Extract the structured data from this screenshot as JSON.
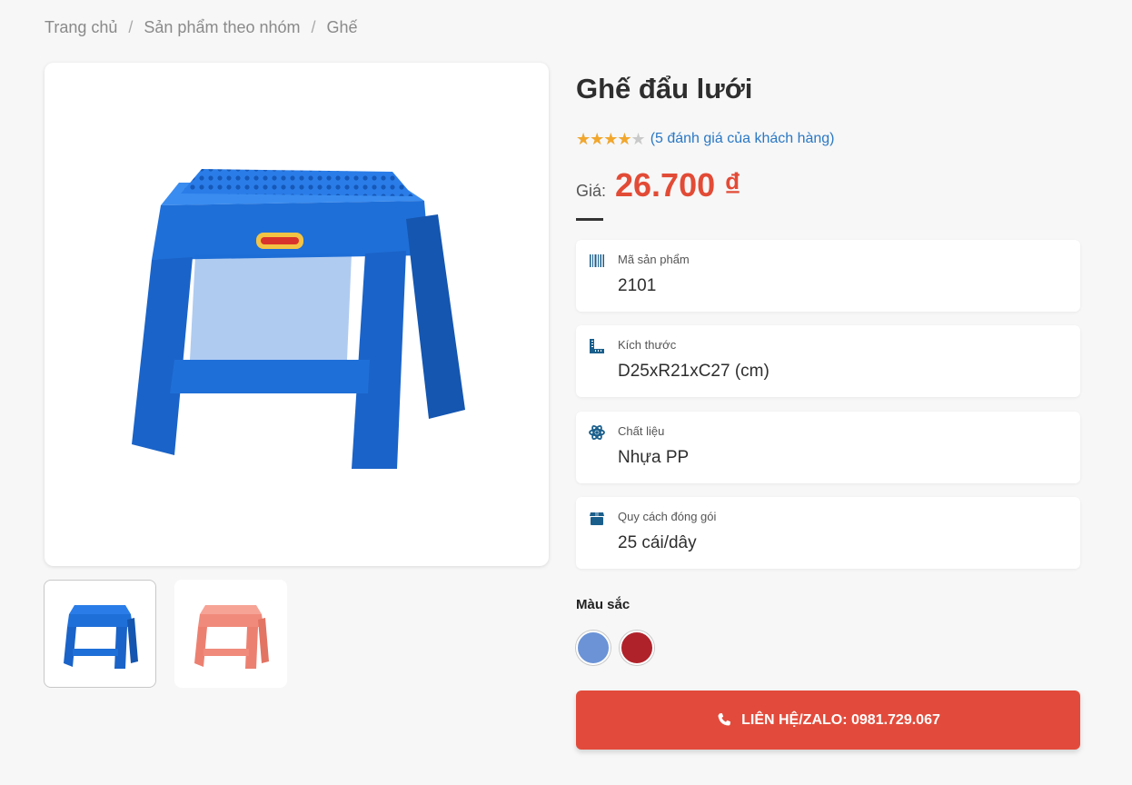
{
  "breadcrumb": {
    "items": [
      "Trang chủ",
      "Sản phẩm theo nhóm",
      "Ghế"
    ],
    "separator": "/"
  },
  "product": {
    "title": "Ghế đẩu lưới",
    "rating": {
      "value": 4,
      "max": 5,
      "review_text": "(5 đánh giá của khách hàng)"
    },
    "price_label": "Giá:",
    "price": "26.700 ₫"
  },
  "gallery": {
    "thumbnails": [
      {
        "color": "#1f6fd8",
        "active": true
      },
      {
        "color": "#f08a7b",
        "active": false
      }
    ]
  },
  "specs": [
    {
      "icon": "barcode-icon",
      "label": "Mã sản phẩm",
      "value": "2101"
    },
    {
      "icon": "ruler-icon",
      "label": "Kích thước",
      "value": "D25xR21xC27 (cm)"
    },
    {
      "icon": "atom-icon",
      "label": "Chất liệu",
      "value": "Nhựa PP"
    },
    {
      "icon": "box-icon",
      "label": "Quy cách đóng gói",
      "value": "25 cái/dây"
    }
  ],
  "colors": {
    "label": "Màu sắc",
    "options": [
      "#6b93d6",
      "#b0222a"
    ]
  },
  "cta": {
    "label": "LIÊN HỆ/ZALO: 0981.729.067",
    "icon": "phone-icon"
  },
  "theme": {
    "accent": "#e24b3b",
    "link": "#2a78c4",
    "icon": "#1a5f8c"
  }
}
